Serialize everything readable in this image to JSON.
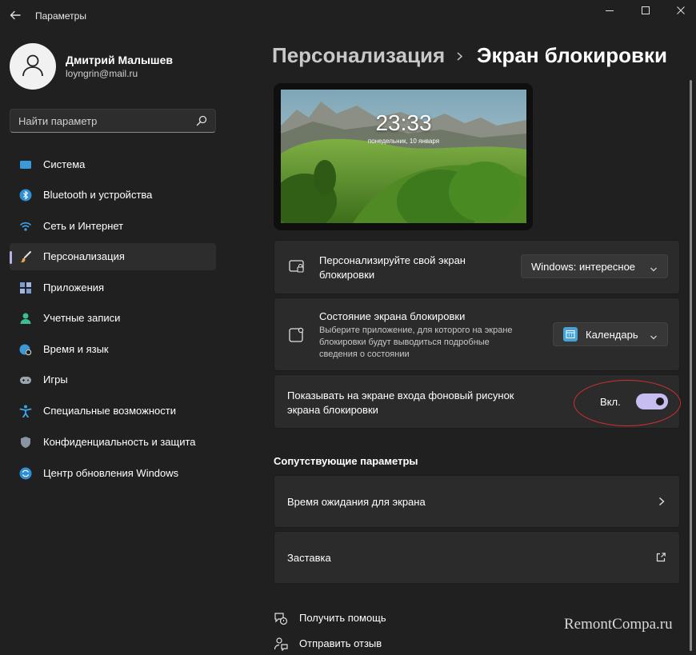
{
  "window": {
    "title": "Параметры",
    "back_icon": "back-arrow-icon",
    "controls": [
      "minimize-icon",
      "maximize-icon",
      "close-icon"
    ]
  },
  "profile": {
    "name": "Дмитрий Малышев",
    "email": "loyngrin@mail.ru",
    "avatar_icon": "person-icon"
  },
  "search": {
    "placeholder": "Найти параметр",
    "icon": "search-icon"
  },
  "sidebar": {
    "items": [
      {
        "label": "Система",
        "icon": "display-icon",
        "icon_color": "#3a9ad9"
      },
      {
        "label": "Bluetooth и устройства",
        "icon": "bluetooth-icon",
        "icon_color": "#2e8fd6"
      },
      {
        "label": "Сеть и Интернет",
        "icon": "wifi-icon",
        "icon_color": "#3aa7e8"
      },
      {
        "label": "Персонализация",
        "icon": "brush-icon",
        "icon_color": "#e3a857",
        "active": true
      },
      {
        "label": "Приложения",
        "icon": "apps-icon",
        "icon_color": "#7a9cd4"
      },
      {
        "label": "Учетные записи",
        "icon": "account-icon",
        "icon_color": "#3bbf8f"
      },
      {
        "label": "Время и язык",
        "icon": "globe-clock-icon",
        "icon_color": "#3a9ad9"
      },
      {
        "label": "Игры",
        "icon": "gamepad-icon",
        "icon_color": "#9aa4ad"
      },
      {
        "label": "Специальные возможности",
        "icon": "accessibility-icon",
        "icon_color": "#3aa7e8"
      },
      {
        "label": "Конфиденциальность и защита",
        "icon": "shield-icon",
        "icon_color": "#8a95a0"
      },
      {
        "label": "Центр обновления Windows",
        "icon": "update-icon",
        "icon_color": "#2e8fd6"
      }
    ]
  },
  "breadcrumb": {
    "parent": "Персонализация",
    "separator_icon": "chevron-right-icon",
    "current": "Экран блокировки"
  },
  "preview": {
    "time": "23:33",
    "date": "понедельник, 10 января"
  },
  "settings": {
    "personalize": {
      "title": "Персонализируйте свой экран блокировки",
      "icon": "lock-screen-icon",
      "value": "Windows: интересное"
    },
    "status": {
      "title": "Состояние экрана блокировки",
      "description": "Выберите приложение, для которого на экране блокировки будут выводиться подробные сведения о состоянии",
      "icon": "status-icon",
      "value": "Календарь",
      "value_icon": "calendar-icon"
    },
    "signin_background": {
      "title": "Показывать на экране входа фоновый рисунок экрана блокировки",
      "toggle_label": "Вкл.",
      "toggle_on": true
    }
  },
  "related": {
    "title": "Сопутствующие параметры",
    "items": [
      {
        "label": "Время ожидания для экрана",
        "icon": "chevron-right-icon"
      },
      {
        "label": "Заставка",
        "icon": "external-link-icon"
      }
    ]
  },
  "links": [
    {
      "label": "Получить помощь",
      "icon": "help-icon"
    },
    {
      "label": "Отправить отзыв",
      "icon": "feedback-icon"
    }
  ],
  "watermark": "RemontCompa.ru",
  "colors": {
    "background": "#202020",
    "card": "#2b2b2b",
    "accent": "#c7bdf0",
    "annotation": "#d32f2f"
  }
}
